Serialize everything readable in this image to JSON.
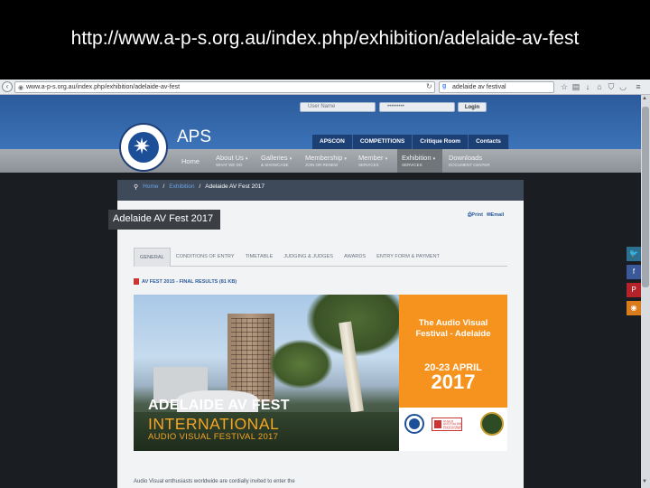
{
  "slide": {
    "caption": "http://www.a-p-s.org.au/index.php/exhibition/adelaide-av-fest"
  },
  "browser": {
    "url": "www.a-p-s.org.au/index.php/exhibition/adelaide-av-fest",
    "search_value": "adelaide av festival",
    "toolbar_icons": [
      "star-icon",
      "bookmark-list-icon",
      "download-icon",
      "home-icon",
      "shield-icon",
      "pocket-icon",
      "menu-icon"
    ]
  },
  "header": {
    "site_name": "APS",
    "login": {
      "username_placeholder": "User Name",
      "password_placeholder": "•••••••••",
      "button": "Login"
    },
    "topnav": [
      "APSCON",
      "COMPETITIONS",
      "Critique Room",
      "Contacts"
    ]
  },
  "mainnav": [
    {
      "label": "Home",
      "sub": ""
    },
    {
      "label": "About Us",
      "sub": "WHAT WE DO"
    },
    {
      "label": "Galleries",
      "sub": "& SHOWCASE"
    },
    {
      "label": "Membership",
      "sub": "JOIN OR RENEW"
    },
    {
      "label": "Member",
      "sub": "SERVICES"
    },
    {
      "label": "Exhibition",
      "sub": "SERVICES"
    },
    {
      "label": "Downloads",
      "sub": "DOCUMENT CENTER"
    }
  ],
  "breadcrumb": {
    "home": "Home",
    "section": "Exhibition",
    "current": "Adelaide AV Fest 2017",
    "sep": "/"
  },
  "page": {
    "title": "Adelaide AV Fest 2017",
    "print": "Print",
    "email": "Email",
    "tabs": [
      "GENERAL",
      "CONDITIONS OF ENTRY",
      "TIMETABLE",
      "JUDGING & JUDGES",
      "AWARDS",
      "ENTRY FORM & PAYMENT"
    ],
    "results_link": "AV FEST 2015 - FINAL RESULTS (81 KB)",
    "intro": "Audio Visual enthusiasts worldwide are cordially invited to enter the"
  },
  "banner": {
    "title_line1": "ADELAIDE AV FEST",
    "title_line2": "INTERNATIONAL",
    "title_line3": "AUDIO VISUAL FESTIVAL 2017",
    "right_heading_1": "The Audio Visual",
    "right_heading_2": "Festival - Adelaide",
    "dates": "20-23 APRIL",
    "year": "2017",
    "sa_badge_text": "SOUTH AUSTRALIAN PHOTOGRAPHIC FEDERATION"
  },
  "social": [
    "twitter-icon",
    "facebook-icon",
    "pinterest-icon",
    "rss-icon"
  ],
  "colors": {
    "header_blue": "#3c73b8",
    "nav_dark": "#1c3f74",
    "accent_orange": "#f5931e",
    "link_blue": "#2c5b9b"
  }
}
